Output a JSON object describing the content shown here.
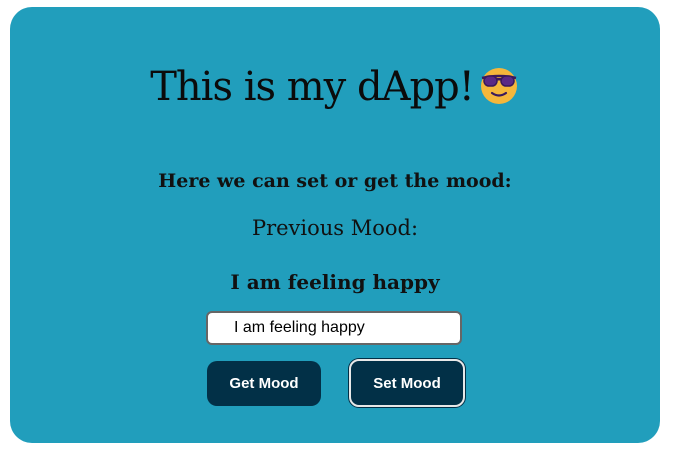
{
  "app": {
    "title": "This is my dApp!",
    "title_emoji": "smiling-face-with-sunglasses",
    "subtitle": "Here we can set or get the mood:",
    "previous_mood_label": "Previous Mood:",
    "current_mood": "I am feeling happy"
  },
  "form": {
    "mood_input_value": "I am feeling happy",
    "get_button_label": "Get Mood",
    "set_button_label": "Set Mood"
  },
  "colors": {
    "card_background": "#219ebc",
    "button_background": "#023047",
    "button_text": "#ffffff",
    "emoji_face": "#f5b73b",
    "emoji_glasses": "#5b2a86"
  }
}
